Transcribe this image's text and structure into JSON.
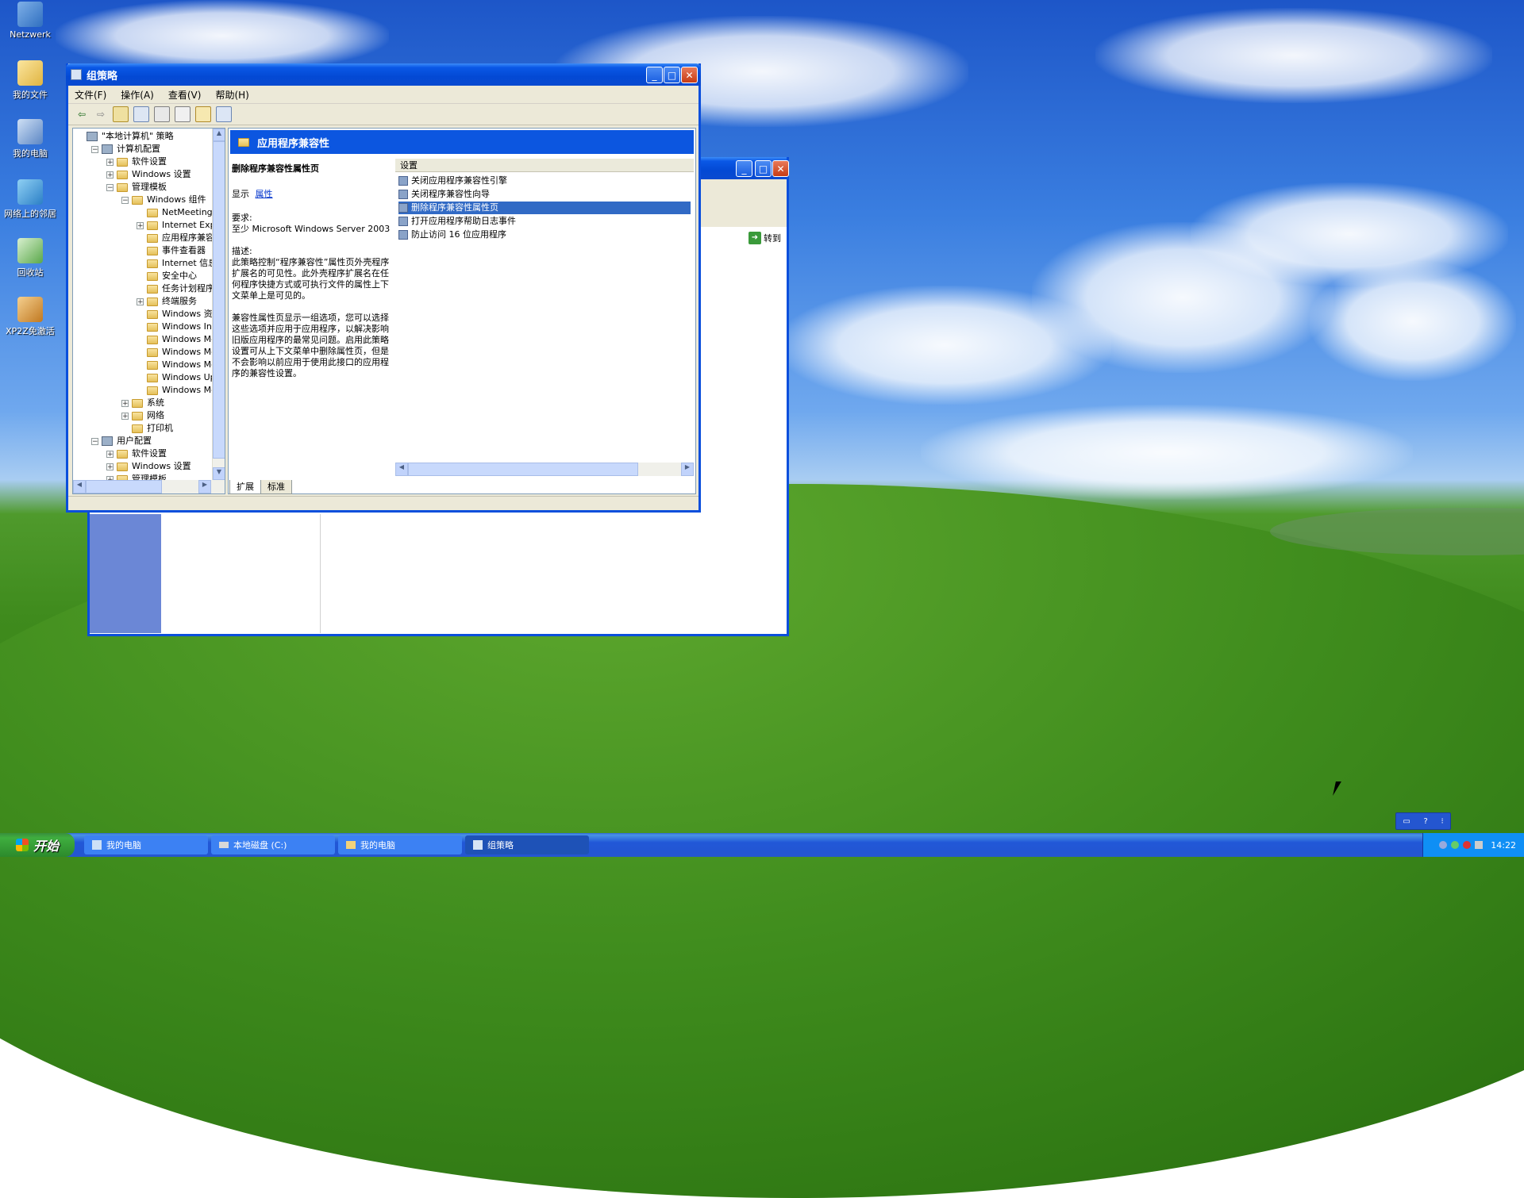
{
  "desktop": {
    "icons": [
      {
        "label": "Netzwerk",
        "icon": "network-icon"
      },
      {
        "label": "我的文件",
        "icon": "my-documents-icon"
      },
      {
        "label": "我的电脑",
        "icon": "my-computer-icon"
      },
      {
        "label": "网络上的邻居",
        "icon": "network-places-icon"
      },
      {
        "label": "回收站",
        "icon": "recycle-bin-icon"
      },
      {
        "label": "XP2Z免激活",
        "icon": "tool-icon"
      }
    ]
  },
  "gpedit": {
    "title": "组策略",
    "menu": [
      "文件(F)",
      "操作(A)",
      "查看(V)",
      "帮助(H)"
    ],
    "tree": [
      {
        "label": "\"本地计算机\" 策略",
        "indent": 0,
        "expander": "",
        "icon": "policy-icon"
      },
      {
        "label": "计算机配置",
        "indent": 1,
        "expander": "−",
        "icon": "computer-icon"
      },
      {
        "label": "软件设置",
        "indent": 2,
        "expander": "+",
        "icon": "folder-icon"
      },
      {
        "label": "Windows 设置",
        "indent": 2,
        "expander": "+",
        "icon": "folder-icon"
      },
      {
        "label": "管理模板",
        "indent": 2,
        "expander": "−",
        "icon": "folder-icon"
      },
      {
        "label": "Windows 组件",
        "indent": 3,
        "expander": "−",
        "icon": "folder-icon"
      },
      {
        "label": "NetMeeting",
        "indent": 4,
        "expander": "",
        "icon": "folder-icon"
      },
      {
        "label": "Internet Exp",
        "indent": 4,
        "expander": "+",
        "icon": "folder-icon"
      },
      {
        "label": "应用程序兼容",
        "indent": 4,
        "expander": "",
        "icon": "folder-open-icon"
      },
      {
        "label": "事件查看器",
        "indent": 4,
        "expander": "",
        "icon": "folder-icon"
      },
      {
        "label": "Internet 信息",
        "indent": 4,
        "expander": "",
        "icon": "folder-icon"
      },
      {
        "label": "安全中心",
        "indent": 4,
        "expander": "",
        "icon": "folder-icon"
      },
      {
        "label": "任务计划程序",
        "indent": 4,
        "expander": "",
        "icon": "folder-icon"
      },
      {
        "label": "终端服务",
        "indent": 4,
        "expander": "+",
        "icon": "folder-icon"
      },
      {
        "label": "Windows 资源",
        "indent": 4,
        "expander": "",
        "icon": "folder-icon"
      },
      {
        "label": "Windows Inst",
        "indent": 4,
        "expander": "",
        "icon": "folder-icon"
      },
      {
        "label": "Windows Mess",
        "indent": 4,
        "expander": "",
        "icon": "folder-icon"
      },
      {
        "label": "Windows Medi",
        "indent": 4,
        "expander": "",
        "icon": "folder-icon"
      },
      {
        "label": "Windows Movi",
        "indent": 4,
        "expander": "",
        "icon": "folder-icon"
      },
      {
        "label": "Windows Upda",
        "indent": 4,
        "expander": "",
        "icon": "folder-icon"
      },
      {
        "label": "Windows Medi",
        "indent": 4,
        "expander": "",
        "icon": "folder-icon"
      },
      {
        "label": "系统",
        "indent": 3,
        "expander": "+",
        "icon": "folder-icon"
      },
      {
        "label": "网络",
        "indent": 3,
        "expander": "+",
        "icon": "folder-icon"
      },
      {
        "label": "打印机",
        "indent": 3,
        "expander": "",
        "icon": "folder-icon"
      },
      {
        "label": "用户配置",
        "indent": 1,
        "expander": "−",
        "icon": "user-icon"
      },
      {
        "label": "软件设置",
        "indent": 2,
        "expander": "+",
        "icon": "folder-icon"
      },
      {
        "label": "Windows 设置",
        "indent": 2,
        "expander": "+",
        "icon": "folder-icon"
      },
      {
        "label": "管理模板",
        "indent": 2,
        "expander": "+",
        "icon": "folder-icon"
      }
    ],
    "header": "应用程序兼容性",
    "detail": {
      "title": "删除程序兼容性属性页",
      "show_label": "显示",
      "show_link": "属性",
      "req_label": "要求:",
      "req_text": "至少 Microsoft Windows Server 2003",
      "desc_label": "描述:",
      "desc_p1": "此策略控制“程序兼容性”属性页外壳程序扩展名的可见性。此外壳程序扩展名在任何程序快捷方式或可执行文件的属性上下文菜单上是可见的。",
      "desc_p2": "兼容性属性页显示一组选项，您可以选择这些选项并应用于应用程序，以解决影响旧版应用程序的最常见问题。启用此策略设置可从上下文菜单中删除属性页，但是不会影响以前应用于使用此接口的应用程序的兼容性设置。"
    },
    "list_header": "设置",
    "settings": [
      {
        "label": "关闭应用程序兼容性引擎",
        "selected": false
      },
      {
        "label": "关闭程序兼容性向导",
        "selected": false
      },
      {
        "label": "删除程序兼容性属性页",
        "selected": true
      },
      {
        "label": "打开应用程序帮助日志事件",
        "selected": false
      },
      {
        "label": "防止访问 16 位应用程序",
        "selected": false
      }
    ],
    "tabs": [
      "扩展",
      "标准"
    ]
  },
  "bg_window": {
    "go_label": "转到"
  },
  "taskbar": {
    "start": "开始",
    "tasks": [
      {
        "label": "我的电脑",
        "active": false
      },
      {
        "label": "本地磁盘 (C:)",
        "active": false
      },
      {
        "label": "我的电脑",
        "active": false
      },
      {
        "label": "组策略",
        "active": true
      }
    ],
    "clock": "14:22"
  },
  "colors": {
    "xp_blue": "#0a4fdc",
    "selection": "#316ac5",
    "header_blue": "#0c56e0"
  }
}
